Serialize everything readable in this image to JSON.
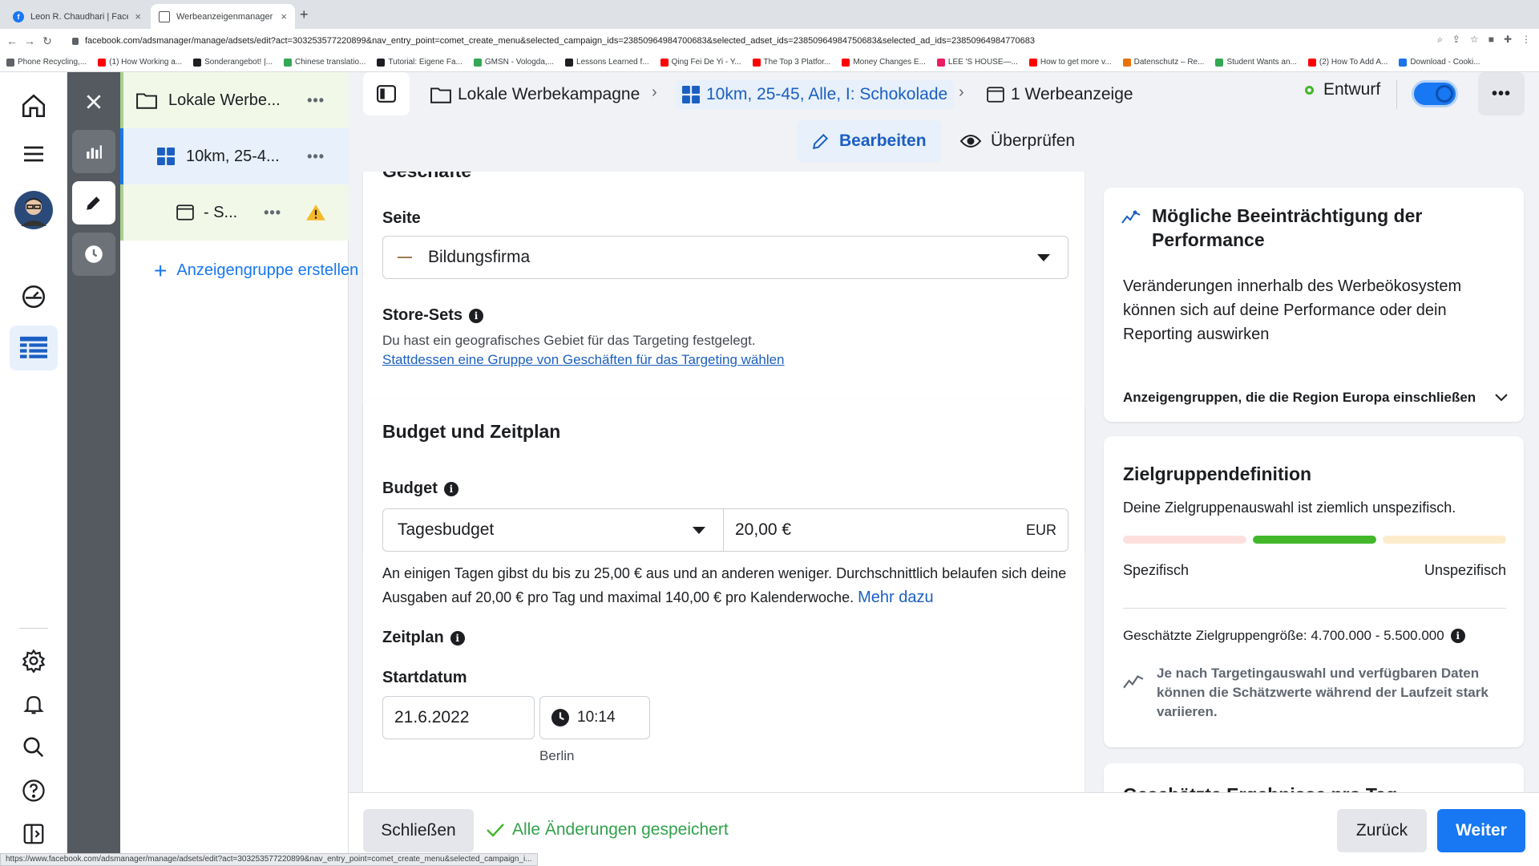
{
  "browser": {
    "tabs": [
      {
        "title": "Leon R. Chaudhari | Facebook"
      },
      {
        "title": "Werbeanzeigenmanager - Wer..."
      }
    ],
    "url": "facebook.com/adsmanager/manage/adsets/edit?act=303253577220899&nav_entry_point=comet_create_menu&selected_campaign_ids=23850964984700683&selected_adset_ids=23850964984750683&selected_ad_ids=23850964984770683",
    "bookmarks": [
      "Phone Recycling,...",
      "(1) How Working a...",
      "Sonderangebot! |...",
      "Chinese translatio...",
      "Tutorial: Eigene Fa...",
      "GMSN - Vologda,...",
      "Lessons Learned f...",
      "Qing Fei De Yi - Y...",
      "The Top 3 Platfor...",
      "Money Changes E...",
      "LEE 'S HOUSE—...",
      "How to get more v...",
      "Datenschutz – Re...",
      "Student Wants an...",
      "(2) How To Add A...",
      "Download - Cooki..."
    ],
    "status_url": "https://www.facebook.com/adsmanager/manage/adsets/edit?act=303253577220899&nav_entry_point=comet_create_menu&selected_campaign_i..."
  },
  "tree": {
    "campaign": "Lokale Werbe...",
    "adset": "10km, 25-4...",
    "ad": "- S...",
    "add_label": "Anzeigengruppe erstellen"
  },
  "header": {
    "crumb_campaign": "Lokale Werbekampagne",
    "crumb_adset": "10km, 25-45, Alle, I: Schokolade",
    "crumb_ad": "1 Werbeanzeige",
    "status": "Entwurf",
    "edit_label": "Bearbeiten",
    "review_label": "Überprüfen"
  },
  "shops": {
    "heading_partial": "Geschäfte",
    "page_label": "Seite",
    "page_value": "Bildungsfirma",
    "store_sets_label": "Store-Sets",
    "store_sets_text": "Du hast ein geografisches Gebiet für das Targeting festgelegt.",
    "store_sets_link": "Stattdessen eine Gruppe von Geschäften für das Targeting wählen"
  },
  "budget": {
    "heading": "Budget und Zeitplan",
    "label": "Budget",
    "type": "Tagesbudget",
    "amount": "20,00 €",
    "currency": "EUR",
    "note": "An einigen Tagen gibst du bis zu 25,00 € aus und an anderen weniger. Durchschnittlich belaufen sich deine Ausgaben auf 20,00 € pro Tag und maximal 140,00 € pro Kalenderwoche.",
    "more_link": "Mehr dazu",
    "schedule_label": "Zeitplan",
    "start_label": "Startdatum",
    "start_date": "21.6.2022",
    "start_time": "10:14",
    "timezone": "Berlin"
  },
  "performance": {
    "title": "Mögliche Beeinträchtigung der Performance",
    "body": "Veränderungen innerhalb des Werbeökosystem können sich auf deine Performance oder dein Reporting auswirken",
    "expander": "Anzeigengruppen, die die Region Europa einschließen"
  },
  "audience": {
    "title": "Zielgruppendefinition",
    "body": "Deine Zielgruppenauswahl ist ziemlich unspezifisch.",
    "left_label": "Spezifisch",
    "right_label": "Unspezifisch",
    "size_text": "Geschätzte Zielgruppengröße: 4.700.000 - 5.500.000",
    "estimate_note": "Je nach Targetingauswahl und verfügbaren Daten können die Schätzwerte während der Laufzeit stark variieren.",
    "next_card_partial": "Geschätzte Ergebnisse pro Tag"
  },
  "footer": {
    "close_label": "Schließen",
    "saved_label": "Alle Änderungen gespeichert",
    "back_label": "Zurück",
    "next_label": "Weiter"
  },
  "colors": {
    "accent": "#1877f2",
    "selected_bg": "#e7f0fb",
    "green": "#42b72a",
    "warning": "#f7b928"
  }
}
